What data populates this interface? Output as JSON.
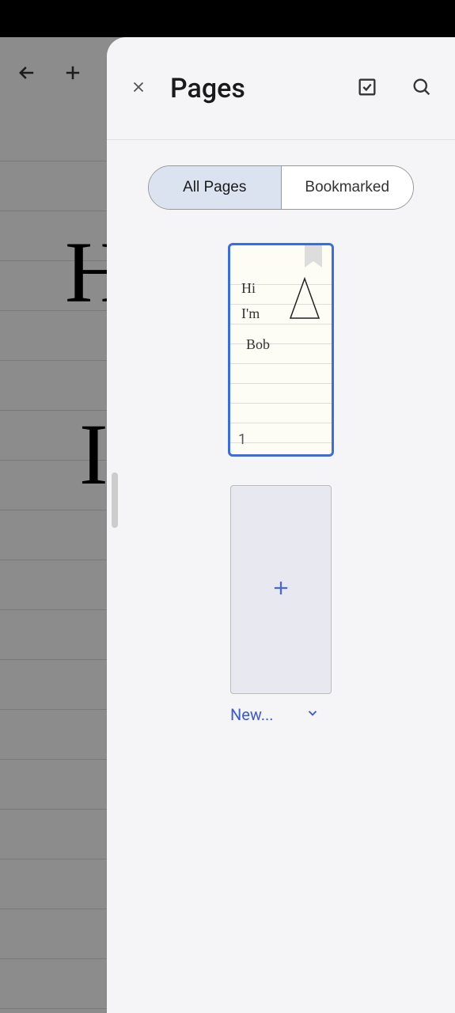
{
  "panel": {
    "title": "Pages",
    "tabs": {
      "all": "All Pages",
      "bookmarked": "Bookmarked"
    },
    "new_label": "New..."
  },
  "pages": [
    {
      "number": "1",
      "handwriting_line1": "Hi",
      "handwriting_line2": "I'm",
      "handwriting_line3": "Bob"
    }
  ],
  "background": {
    "handwriting_partial_1": "H",
    "handwriting_partial_2": "I"
  }
}
